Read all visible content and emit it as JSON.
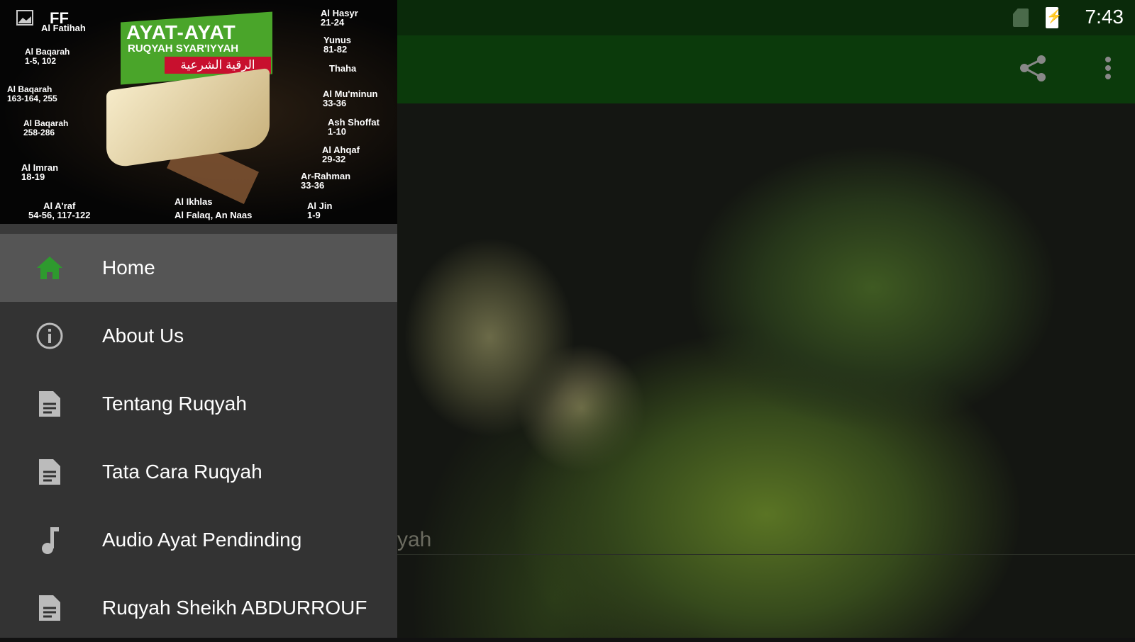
{
  "status_bar": {
    "time": "7:43",
    "icons": [
      "no-sim-icon",
      "battery-charging-icon"
    ]
  },
  "toolbar": {
    "actions": [
      "share-icon",
      "more-vert-icon"
    ]
  },
  "background": {
    "faded_text": "yah"
  },
  "drawer": {
    "header": {
      "image_icon": "image-icon",
      "logo_text": "FF",
      "title": "AYAT-AYAT",
      "subtitle": "RUQYAH SYAR'IYYAH",
      "arabic": "الرقية الشرعية",
      "labels": [
        "Al Fatihah",
        "Al Baqarah\n1-5, 102",
        "Al Baqarah\n163-164, 255",
        "Al Baqarah\n258-286",
        "Al Imran\n18-19",
        "Al A'raf\n54-56, 117-122",
        "Al Ikhlas",
        "Al Falaq, An Naas",
        "Al Hasyr\n21-24",
        "Yunus\n81-82",
        "Thaha",
        "Al Mu'minun\n33-36",
        "Ash Shoffat\n1-10",
        "Al Ahqaf\n29-32",
        "Ar-Rahman\n33-36",
        "Al Jin\n1-9"
      ]
    },
    "items": [
      {
        "label": "Home",
        "icon": "home-icon",
        "active": true
      },
      {
        "label": "About Us",
        "icon": "info-icon"
      },
      {
        "label": "Tentang Ruqyah",
        "icon": "document-icon"
      },
      {
        "label": "Tata Cara Ruqyah",
        "icon": "document-icon"
      },
      {
        "label": "Audio Ayat Pendinding",
        "icon": "music-note-icon"
      },
      {
        "label": "Ruqyah Sheikh ABDURROUF",
        "icon": "document-icon"
      }
    ],
    "accent": "#2e9a2e"
  }
}
